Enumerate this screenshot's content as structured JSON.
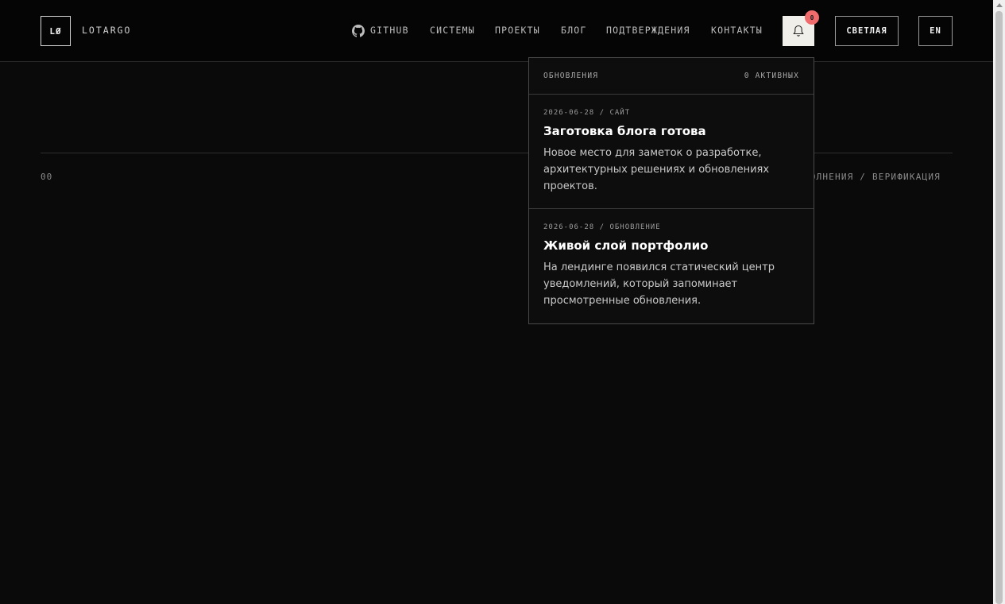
{
  "header": {
    "logo_mark": "LØ",
    "logo_text": "LOTARGO",
    "nav": [
      {
        "label": "GITHUB"
      },
      {
        "label": "СИСТЕМЫ"
      },
      {
        "label": "ПРОЕКТЫ"
      },
      {
        "label": "БЛОГ"
      },
      {
        "label": "ПОДТВЕРЖДЕНИЯ"
      },
      {
        "label": "КОНТАКТЫ"
      }
    ],
    "notification_badge": "0",
    "theme_button": "СВЕТЛАЯ",
    "lang_button": "EN"
  },
  "section": {
    "number": "00",
    "path": "ОЛНЕНИЯ / ВЕРИФИКАЦИЯ"
  },
  "notifications": {
    "title": "ОБНОВЛЕНИЯ",
    "active": "0 АКТИВНЫХ",
    "items": [
      {
        "meta": "2026-06-28 / САЙТ",
        "title": "Заготовка блога готова",
        "text": "Новое место для заметок о разработке, архитектурных решениях и обновлениях проектов."
      },
      {
        "meta": "2026-06-28 / ОБНОВЛЕНИЕ",
        "title": "Живой слой портфолио",
        "text": "На лендинге появился статический центр уведомлений, который запоминает просмотренные обновления."
      }
    ]
  },
  "colors": {
    "background": "#0a0a0a",
    "badge": "#f06b6b",
    "bell_button": "#f1efe9"
  },
  "icons": {
    "github": "github-icon",
    "bell": "bell-icon"
  }
}
